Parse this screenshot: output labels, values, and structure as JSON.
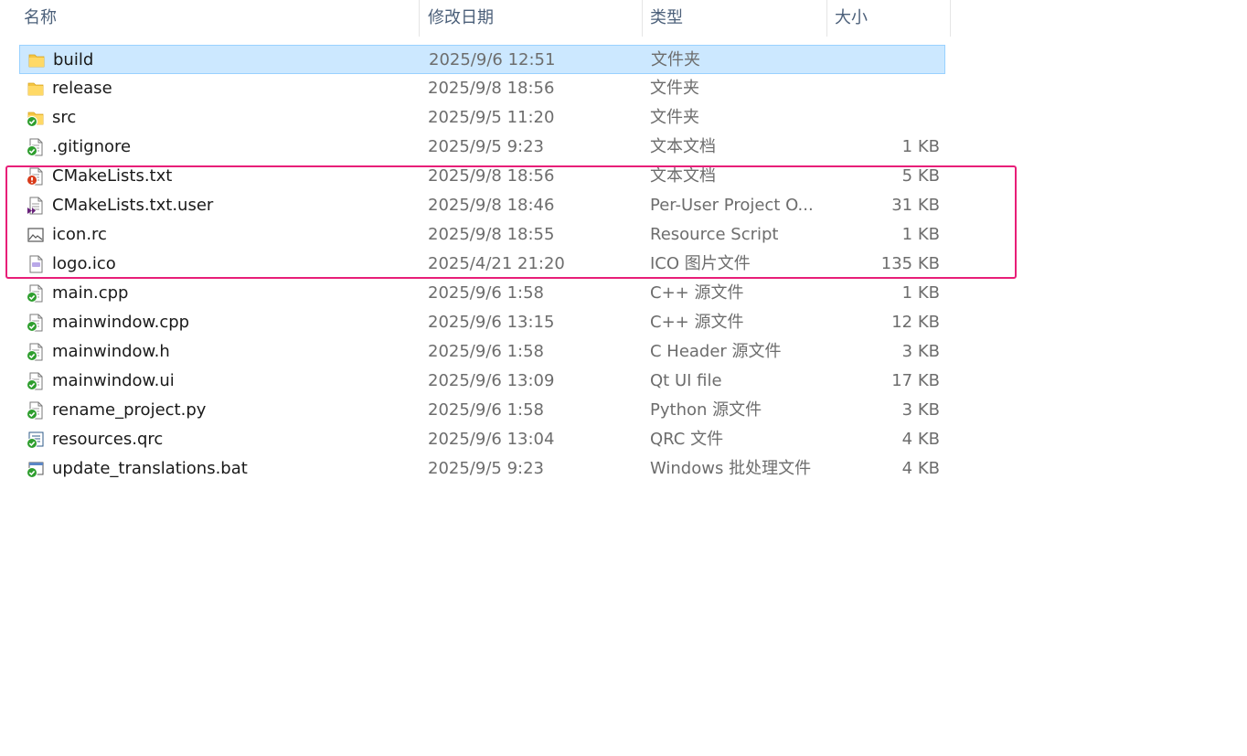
{
  "columns": {
    "name": "名称",
    "date": "修改日期",
    "type": "类型",
    "size": "大小"
  },
  "sort_indicator": "^",
  "files": [
    {
      "name": "build",
      "date": "2025/9/6 12:51",
      "type": "文件夹",
      "size": "",
      "icon": "folder-icon"
    },
    {
      "name": "release",
      "date": "2025/9/8 18:56",
      "type": "文件夹",
      "size": "",
      "icon": "folder-icon"
    },
    {
      "name": "src",
      "date": "2025/9/5 11:20",
      "type": "文件夹",
      "size": "",
      "icon": "folder-synced-icon"
    },
    {
      "name": ".gitignore",
      "date": "2025/9/5 9:23",
      "type": "文本文档",
      "size": "1 KB",
      "icon": "text-file-synced-icon"
    },
    {
      "name": "CMakeLists.txt",
      "date": "2025/9/8 18:56",
      "type": "文本文档",
      "size": "5 KB",
      "icon": "text-file-conflict-icon"
    },
    {
      "name": "CMakeLists.txt.user",
      "date": "2025/9/8 18:46",
      "type": "Per-User Project O...",
      "size": "31 KB",
      "icon": "visual-studio-file-icon"
    },
    {
      "name": "icon.rc",
      "date": "2025/9/8 18:55",
      "type": "Resource Script",
      "size": "1 KB",
      "icon": "image-file-icon"
    },
    {
      "name": "logo.ico",
      "date": "2025/4/21 21:20",
      "type": "ICO 图片文件",
      "size": "135 KB",
      "icon": "ico-file-icon"
    },
    {
      "name": "main.cpp",
      "date": "2025/9/6 1:58",
      "type": "C++ 源文件",
      "size": "1 KB",
      "icon": "source-file-synced-icon"
    },
    {
      "name": "mainwindow.cpp",
      "date": "2025/9/6 13:15",
      "type": "C++ 源文件",
      "size": "12 KB",
      "icon": "source-file-synced-icon"
    },
    {
      "name": "mainwindow.h",
      "date": "2025/9/6 1:58",
      "type": "C Header 源文件",
      "size": "3 KB",
      "icon": "source-file-synced-icon"
    },
    {
      "name": "mainwindow.ui",
      "date": "2025/9/6 13:09",
      "type": "Qt UI file",
      "size": "17 KB",
      "icon": "source-file-synced-icon"
    },
    {
      "name": "rename_project.py",
      "date": "2025/9/6 1:58",
      "type": "Python 源文件",
      "size": "3 KB",
      "icon": "source-file-synced-icon"
    },
    {
      "name": "resources.qrc",
      "date": "2025/9/6 13:04",
      "type": "QRC 文件",
      "size": "4 KB",
      "icon": "qrc-file-synced-icon"
    },
    {
      "name": "update_translations.bat",
      "date": "2025/9/5 9:23",
      "type": "Windows 批处理文件",
      "size": "4 KB",
      "icon": "batch-file-synced-icon"
    }
  ],
  "selected_row": 0,
  "highlighted_rows": [
    4,
    5,
    6,
    7
  ],
  "colors": {
    "selection_bg": "#cce8ff",
    "selection_border": "#99d1ff",
    "highlight_border": "#e81e78",
    "sync_green": "#2e9e2e",
    "conflict_red": "#d83b1a",
    "folder_yellow": "#f4c542"
  }
}
